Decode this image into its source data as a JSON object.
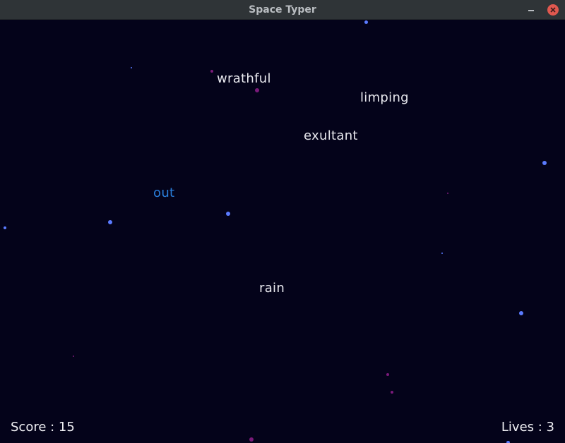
{
  "window": {
    "title": "Space Typer"
  },
  "words": [
    {
      "text": "wrathful",
      "typed": false
    },
    {
      "text": "limping",
      "typed": false
    },
    {
      "text": "exultant",
      "typed": false
    },
    {
      "text": "out",
      "typed": true
    },
    {
      "text": "rain",
      "typed": false
    }
  ],
  "hud": {
    "score_text": "Score : 15",
    "lives_text": "Lives : 3"
  },
  "colors": {
    "background": "#04031a",
    "word": "#e8e8ee",
    "active_word": "#2a7fdc",
    "star_blue": "#5b7bff",
    "star_purple": "#7a1a7a"
  }
}
